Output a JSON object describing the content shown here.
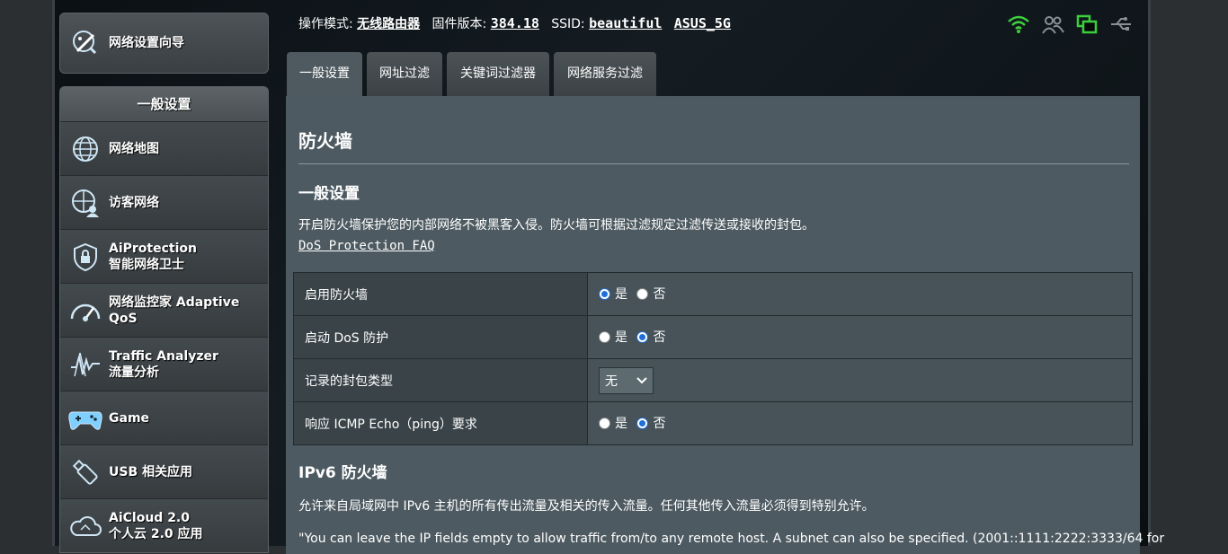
{
  "status": {
    "mode_label": "操作模式:",
    "mode_value": "无线路由器",
    "firmware_label": "固件版本:",
    "firmware_value": "384.18",
    "ssid_label": "SSID:",
    "ssid_1": "beautiful",
    "ssid_2": "ASUS_5G"
  },
  "sidebar": {
    "qis_label": "网络设置向导",
    "section_title": "一般设置",
    "items": [
      {
        "line1": "网络地图",
        "line2": ""
      },
      {
        "line1": "访客网络",
        "line2": ""
      },
      {
        "line1": "AiProtection",
        "line2": "智能网络卫士"
      },
      {
        "line1": "网络监控家 Adaptive",
        "line2": "QoS"
      },
      {
        "line1": "Traffic Analyzer",
        "line2": "流量分析"
      },
      {
        "line1": "Game",
        "line2": ""
      },
      {
        "line1": "USB 相关应用",
        "line2": ""
      },
      {
        "line1": "AiCloud 2.0",
        "line2": "个人云 2.0 应用"
      }
    ]
  },
  "tabs": [
    "一般设置",
    "网址过滤",
    "关键词过滤器",
    "网络服务过滤"
  ],
  "content": {
    "title": "防火墙",
    "general_title": "一般设置",
    "general_desc": "开启防火墙保护您的内部网络不被黑客入侵。防火墙可根据过滤规定过滤传送或接收的封包。",
    "faq_link": "DoS Protection FAQ",
    "rows": [
      {
        "label": "启用防火墙",
        "type": "radio",
        "yes": "是",
        "no": "否",
        "value": "yes"
      },
      {
        "label": "启动 DoS 防护",
        "type": "radio",
        "yes": "是",
        "no": "否",
        "value": "no"
      },
      {
        "label": "记录的封包类型",
        "type": "select",
        "value": "无"
      },
      {
        "label": "响应 ICMP Echo（ping）要求",
        "type": "radio",
        "yes": "是",
        "no": "否",
        "value": "no"
      }
    ],
    "ipv6_title": "IPv6 防火墙",
    "ipv6_desc": "允许来自局域网中 IPv6 主机的所有传出流量及相关的传入流量。任何其他传入流量必须得到特别允许。",
    "ipv6_note": "\"You can leave the IP fields empty to allow traffic from/to any remote host. A subnet can also be specified. (2001::1111:2222:3333/64 for"
  },
  "colors": {
    "accent": "#1f6fd6",
    "status_green": "#3ccf3c",
    "panel": "#4d5a61"
  }
}
